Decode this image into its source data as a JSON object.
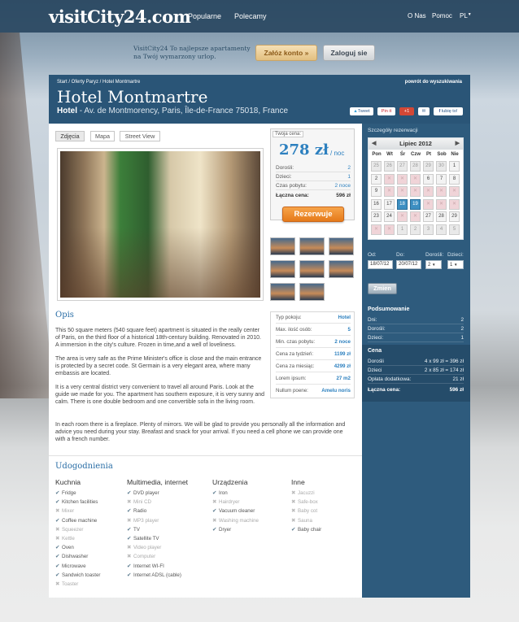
{
  "header": {
    "logo": "visitCity24.com",
    "nav": [
      "Popularne",
      "Polecamy"
    ],
    "subnav": [
      "O Nas",
      "Pomoc",
      "PL"
    ]
  },
  "promo": {
    "text": "VisitCity24 To najlepsze apartamenty na Twój wymarzony urlop.",
    "register": "Załóz konto »",
    "login": "Zaloguj sie"
  },
  "hotel": {
    "breadcrumb": "Start / Oferty Paryz / Hotel Montmartre",
    "back": "powrót do wyszukiwania",
    "title": "Hotel Montmartre",
    "type": "Hotel",
    "address": " - Av. de Montmorency, Paris, Île-de-France 75018, France",
    "share": [
      "Tweet",
      "Pin it",
      "+1",
      "",
      "lubię to!"
    ]
  },
  "tabs": [
    "Zdjęcia",
    "Mapa",
    "Street View"
  ],
  "price": {
    "label": "Twoja cena:",
    "amount": "278 zł",
    "unit": "/ noc",
    "rows": [
      {
        "k": "Dorośli:",
        "v": "2"
      },
      {
        "k": "Dzieci:",
        "v": "1"
      },
      {
        "k": "Czas pobytu:",
        "v": "2 noce"
      },
      {
        "k": "Łączna cena:",
        "v": "596 zł"
      }
    ],
    "book": "Rezerwuje"
  },
  "description": {
    "title": "Opis",
    "paragraphs": [
      "This 50 square meters (540 square feet) apartment is situated in the really center of Paris, on the third floor of a historical 18th-century building. Renovated in 2010. A immersion in the city's culture. Frozen in time,and a well of loveliness.",
      "The area is very safe as the Prime Minister's office is close and the main entrance is protected by a secret code. St Germain is a very elegant area, where many embassis are located.",
      "It is a very central district very convenient to travel all around Paris. Look at the guide we made for you. The apartment has southern exposure, it is very sunny and calm. There is one double bedroom and one convertible sofa in the living room.",
      "In each room there is a fireplace. Plenty of mirrors. We will be glad to provide you personally all the information and advice you need during your stay. Breafast and snack for your arrival. If you need a cell phone we can provide one with a french number."
    ]
  },
  "info": [
    {
      "k": "Typ pokoju:",
      "v": "Hotel"
    },
    {
      "k": "Max. ilość osób:",
      "v": "5"
    },
    {
      "k": "Min. czas pobytu:",
      "v": "2 noce"
    },
    {
      "k": "Cena za tydzień:",
      "v": "1199 zł"
    },
    {
      "k": "Cena za miesiąc:",
      "v": "4299 zł"
    },
    {
      "k": "Lorem ipsum:",
      "v": "27 m2"
    },
    {
      "k": "Nullum poene:",
      "v": "Amelu noris"
    }
  ],
  "amenities": {
    "title": "Udogodnienia",
    "columns": [
      {
        "title": "Kuchnia",
        "items": [
          {
            "t": "Fridge",
            "on": true
          },
          {
            "t": "Kitchen facilities",
            "on": true
          },
          {
            "t": "Mixer",
            "on": false
          },
          {
            "t": "Coffee machine",
            "on": true
          },
          {
            "t": "Squeezer",
            "on": false
          },
          {
            "t": "Kettle",
            "on": false
          },
          {
            "t": "Oven",
            "on": true
          },
          {
            "t": "Dishwasher",
            "on": true
          },
          {
            "t": "Microwave",
            "on": true
          },
          {
            "t": "Sandwich toaster",
            "on": true
          },
          {
            "t": "Toaster",
            "on": false
          }
        ]
      },
      {
        "title": "Multimedia, internet",
        "items": [
          {
            "t": "DVD player",
            "on": true
          },
          {
            "t": "Mini CD",
            "on": false
          },
          {
            "t": "Radio",
            "on": true
          },
          {
            "t": "MP3 player",
            "on": false
          },
          {
            "t": "TV",
            "on": true
          },
          {
            "t": "Satellite TV",
            "on": true
          },
          {
            "t": "Video player",
            "on": false
          },
          {
            "t": "Computer",
            "on": false
          },
          {
            "t": "Internet WI-FI",
            "on": true
          },
          {
            "t": "Internet ADSL (cable)",
            "on": true
          }
        ]
      },
      {
        "title": "Urządzenia",
        "items": [
          {
            "t": "Iron",
            "on": true
          },
          {
            "t": "Hairdryer",
            "on": false
          },
          {
            "t": "Vacuum cleaner",
            "on": true
          },
          {
            "t": "Washing machine",
            "on": false
          },
          {
            "t": "Dryer",
            "on": true
          }
        ]
      },
      {
        "title": "Inne",
        "items": [
          {
            "t": "Jacuzzi",
            "on": false
          },
          {
            "t": "Safe-box",
            "on": false
          },
          {
            "t": "Baby cot",
            "on": false
          },
          {
            "t": "Sauna",
            "on": false
          },
          {
            "t": "Baby chair",
            "on": true
          }
        ]
      }
    ]
  },
  "sidebar": {
    "details": "Szczegóły rezerwacji",
    "month": "Lipiec 2012",
    "dow": [
      "Pon",
      "Wt",
      "Śr",
      "Czw",
      "Pt",
      "Sob",
      "Nie"
    ],
    "days": [
      [
        {
          "d": "25",
          "s": "out"
        },
        {
          "d": "26",
          "s": "out"
        },
        {
          "d": "27",
          "s": "out"
        },
        {
          "d": "28",
          "s": "out"
        },
        {
          "d": "29",
          "s": "out"
        },
        {
          "d": "30",
          "s": "out"
        },
        {
          "d": "1",
          "s": ""
        }
      ],
      [
        {
          "d": "2",
          "s": ""
        },
        {
          "d": "",
          "s": "x"
        },
        {
          "d": "",
          "s": "x"
        },
        {
          "d": "",
          "s": "x"
        },
        {
          "d": "6",
          "s": ""
        },
        {
          "d": "7",
          "s": ""
        },
        {
          "d": "8",
          "s": ""
        }
      ],
      [
        {
          "d": "9",
          "s": ""
        },
        {
          "d": "",
          "s": "x"
        },
        {
          "d": "",
          "s": "x"
        },
        {
          "d": "",
          "s": "x"
        },
        {
          "d": "",
          "s": "x"
        },
        {
          "d": "",
          "s": "x"
        },
        {
          "d": "",
          "s": "x"
        }
      ],
      [
        {
          "d": "16",
          "s": ""
        },
        {
          "d": "17",
          "s": ""
        },
        {
          "d": "18",
          "s": "sel"
        },
        {
          "d": "19",
          "s": "sel"
        },
        {
          "d": "",
          "s": "x"
        },
        {
          "d": "",
          "s": "x"
        },
        {
          "d": "",
          "s": "x"
        }
      ],
      [
        {
          "d": "23",
          "s": ""
        },
        {
          "d": "24",
          "s": ""
        },
        {
          "d": "",
          "s": "x"
        },
        {
          "d": "",
          "s": "x"
        },
        {
          "d": "27",
          "s": ""
        },
        {
          "d": "28",
          "s": ""
        },
        {
          "d": "29",
          "s": ""
        }
      ],
      [
        {
          "d": "",
          "s": "x"
        },
        {
          "d": "",
          "s": "x"
        },
        {
          "d": "1",
          "s": "out"
        },
        {
          "d": "2",
          "s": "out"
        },
        {
          "d": "3",
          "s": "out"
        },
        {
          "d": "4",
          "s": "out"
        },
        {
          "d": "5",
          "s": "out"
        }
      ]
    ],
    "labels": {
      "from": "Od:",
      "to": "Do:",
      "adults": "Dorośli:",
      "kids": "Dzieci:"
    },
    "fields": {
      "from": "18/07/12",
      "to": "20/07/12",
      "adults": "2",
      "kids": "1"
    },
    "change": "Zmien",
    "summary": {
      "title": "Podsumowanie",
      "rows": [
        {
          "k": "Dni:",
          "v": "2"
        },
        {
          "k": "Dorośli:",
          "v": "2"
        },
        {
          "k": "Dzieci:",
          "v": "1"
        }
      ]
    },
    "cena": {
      "title": "Cena",
      "rows": [
        {
          "k": "Dorośli",
          "v": "4 x 99 zł = 396 zł"
        },
        {
          "k": "Dzieci",
          "v": "2 x 85 zł = 174 zł"
        },
        {
          "k": "Opłata dodatkowa:",
          "v": "21 zł"
        },
        {
          "k": "Łączna cena:",
          "v": "596 zł"
        }
      ]
    }
  },
  "colors": {
    "brand": "#2a5577",
    "accent": "#2d80bf",
    "book": "#e57a1a"
  }
}
